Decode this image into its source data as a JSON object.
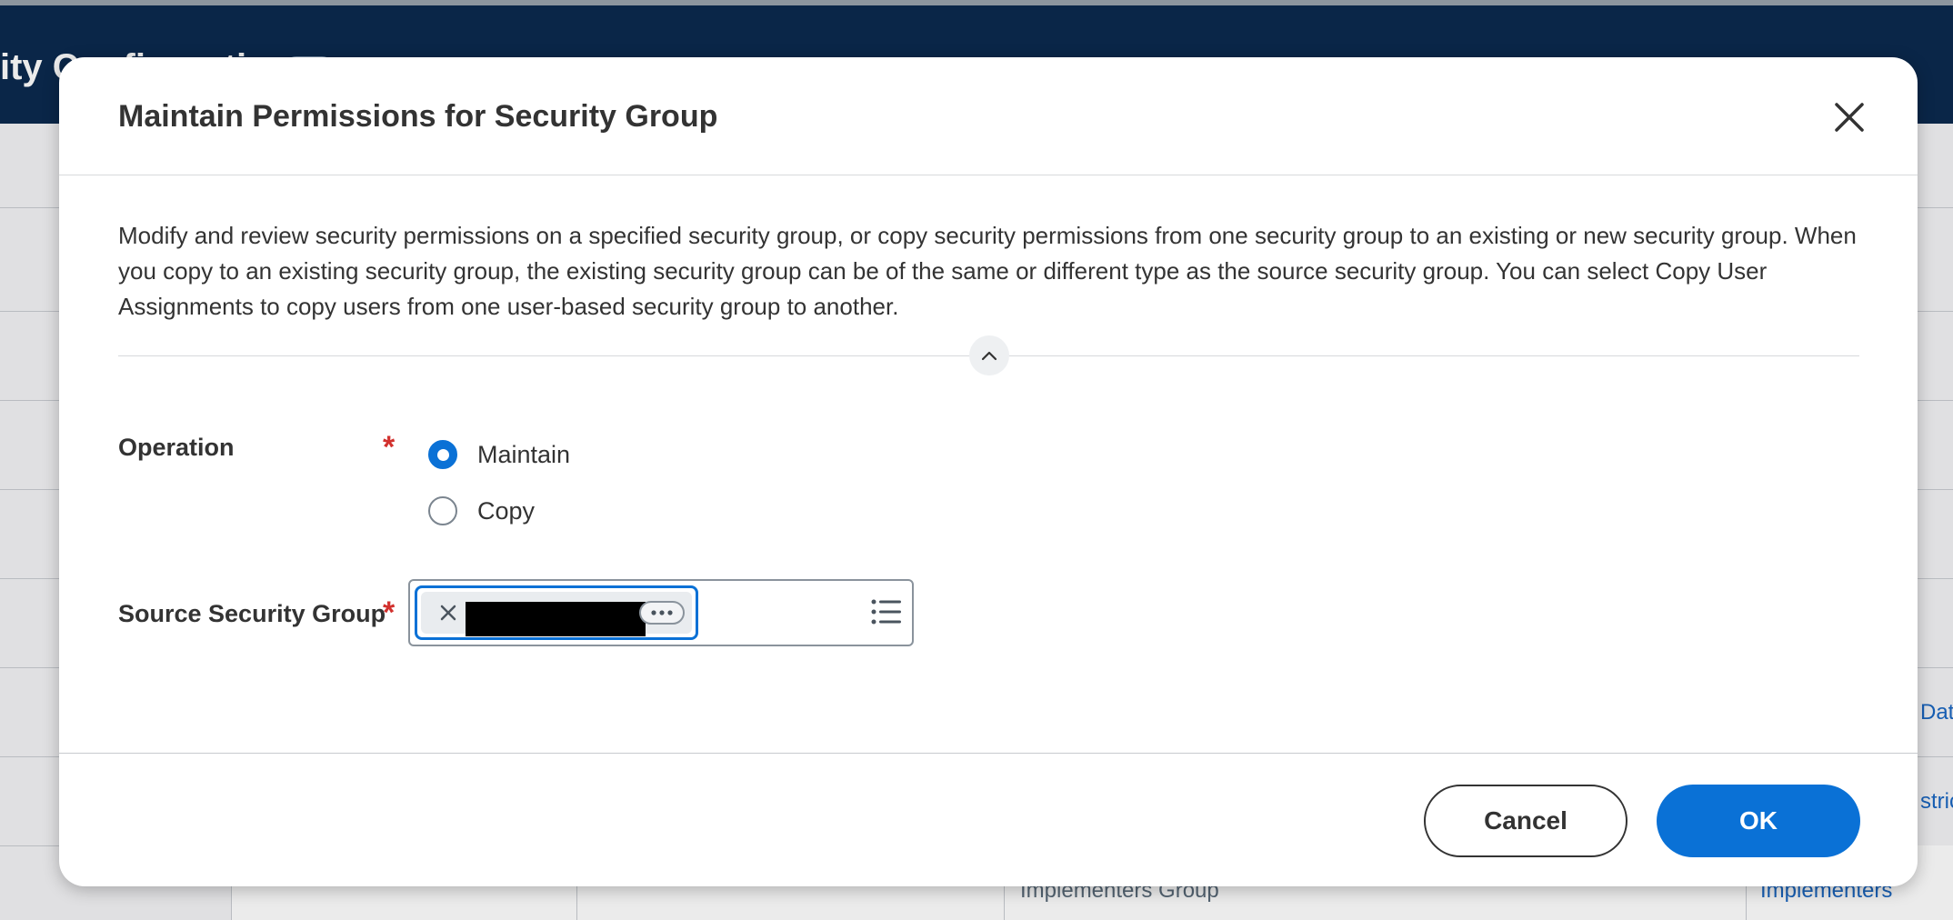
{
  "background": {
    "header_title": "ity Configuration",
    "table_texts": {
      "implementers_group": "Implementers Group",
      "implementers_link": "Implementers",
      "date_fragment": "Dat",
      "restrict_fragment": "stric"
    }
  },
  "modal": {
    "title": "Maintain Permissions for Security Group",
    "close_icon": "close-icon",
    "description": "Modify and review security permissions on a specified security group, or copy security permissions from one security group to an existing or new security group. When you copy to an existing security group, the existing security group can be of the same or different type as the source security group. You can select Copy User Assignments to copy users from one user-based security group to another.",
    "collapse_icon": "chevron-up-icon",
    "operation": {
      "label": "Operation",
      "required_mark": "*",
      "options": [
        {
          "label": "Maintain",
          "selected": true
        },
        {
          "label": "Copy",
          "selected": false
        }
      ]
    },
    "source_group": {
      "label": "Source Security Group",
      "required_mark": "*",
      "remove_icon": "close-icon",
      "more_icon": "more-horizontal-icon",
      "list_icon": "list-icon"
    },
    "buttons": {
      "cancel": "Cancel",
      "ok": "OK"
    }
  },
  "colors": {
    "accent": "#0a71d6",
    "header_bg": "#0b2a4f",
    "required": "#d2312e",
    "text": "#333333"
  }
}
